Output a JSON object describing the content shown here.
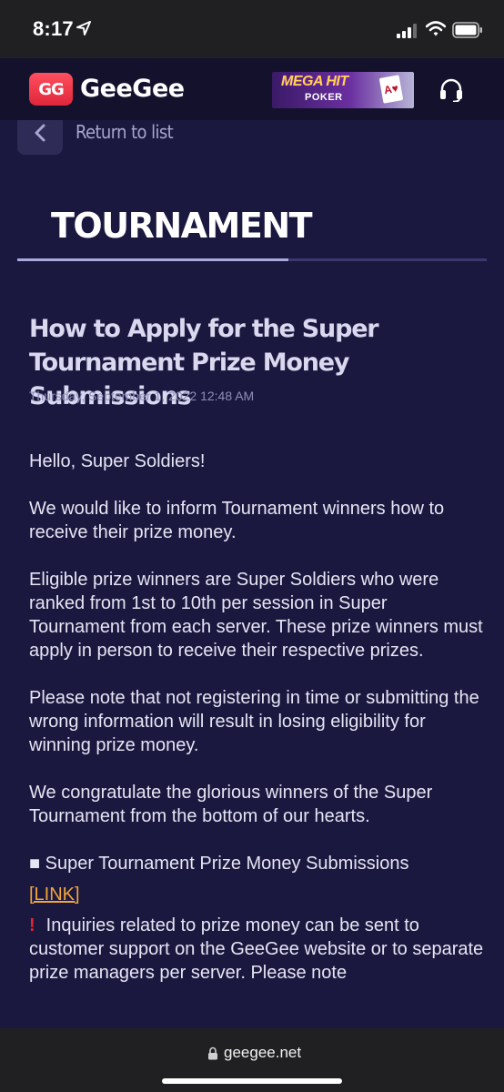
{
  "status_bar": {
    "time": "8:17"
  },
  "header": {
    "logo_mark": "GG",
    "brand": "GeeGee",
    "promo": {
      "line1": "MEGA HIT",
      "line2": "POKER",
      "card": "A♥"
    },
    "icons": [
      "location-arrow-icon",
      "signal-icon",
      "wifi-icon",
      "battery-icon",
      "headset-icon"
    ]
  },
  "nav": {
    "return_label": "Return to list"
  },
  "section": {
    "title": "TOURNAMENT"
  },
  "article": {
    "title": "How to Apply for the Super Tournament Prize Money Submissions",
    "date": "Thursday, September 1, 2022 12:48 AM",
    "paragraphs": [
      "Hello, Super Soldiers!",
      "We would like to inform Tournament winners how to receive their prize money.",
      "Eligible prize winners are Super Soldiers who were ranked from 1st to 10th per session in Super Tournament from each server. These prize winners must apply in person to receive their respective prizes.",
      "Please note that not registering in time or submitting the wrong information will result in losing eligibility for winning prize money.",
      "We congratulate the glorious winners of the Super Tournament from the bottom of our hearts.",
      "■ Super Tournament Prize Money Submissions"
    ],
    "link_label": "[LINK]",
    "notice_mark": "!",
    "notice": "Inquiries related to prize money can be sent to customer support on the GeeGee website or to separate prize managers per server. Please note"
  },
  "browser": {
    "url": "geegee.net"
  },
  "colors": {
    "background": "#1b1840",
    "header": "#13112c",
    "accent_red": "#e0263b",
    "link": "#f1a53a",
    "indicator": "#a8a9d8"
  }
}
